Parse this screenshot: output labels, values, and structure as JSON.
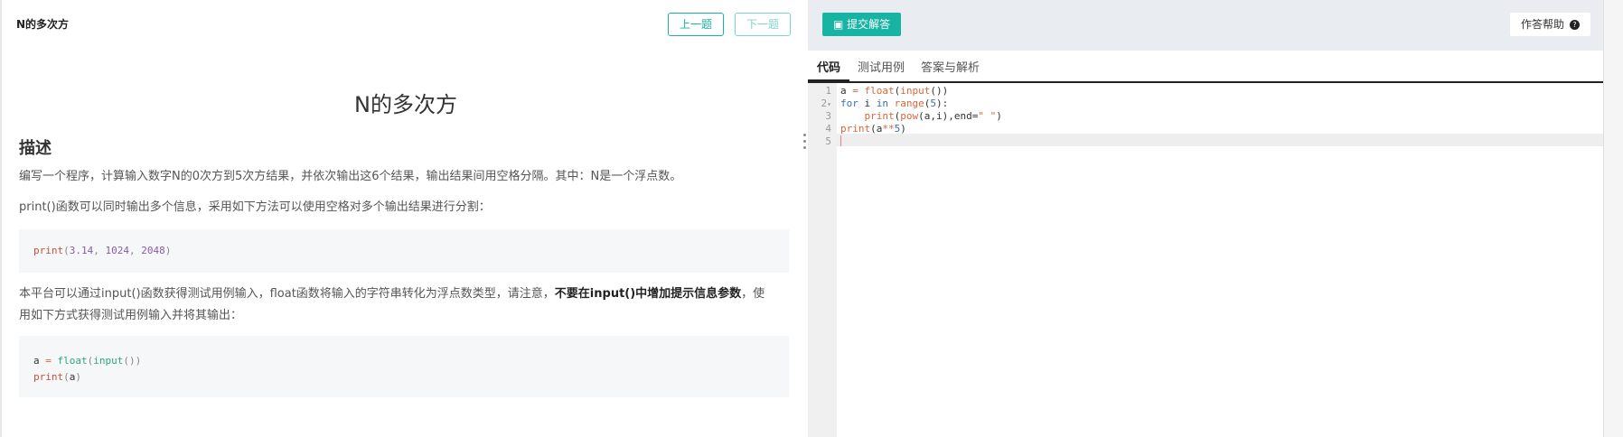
{
  "left": {
    "breadcrumb": "N的多次方",
    "prev_label": "上一题",
    "next_label": "下一题",
    "title": "N的多次方",
    "section_heading": "描述",
    "para1": "编写一个程序，计算输入数字N的0次方到5次方结果，并依次输出这6个结果，输出结果间用空格分隔。其中：N是一个浮点数。",
    "para2": "print()函数可以同时输出多个信息，采用如下方法可以使用空格对多个输出结果进行分割：",
    "code1": {
      "fn": "print",
      "open": "(",
      "a": "3.14",
      "b": "1024",
      "c": "2048",
      "close": ")",
      "sep": ", "
    },
    "para3_a": "本平台可以通过input()函数获得测试用例输入，float函数将输入的字符串转化为浮点数类型，请注意，",
    "para3_bold": "不要在input()中增加提示信息参数",
    "para3_b": "，使用如下方式获得测试用例输入并将其输出：",
    "code2": {
      "l1_var": "a",
      "l1_op": " = ",
      "l1_fn": "float",
      "l1_inner": "input",
      "l1_paren": "()",
      "l2_fn": "print",
      "l2_arg": "a"
    }
  },
  "right": {
    "submit_label": "提交解答",
    "help_label": "作答帮助",
    "help_icon": "?",
    "tabs": [
      "代码",
      "测试用例",
      "答案与解析"
    ],
    "line_numbers": [
      "1",
      "2",
      "3",
      "4",
      "5"
    ],
    "fold_marker": "▾"
  },
  "colors": {
    "accent": "#17b3a3"
  }
}
